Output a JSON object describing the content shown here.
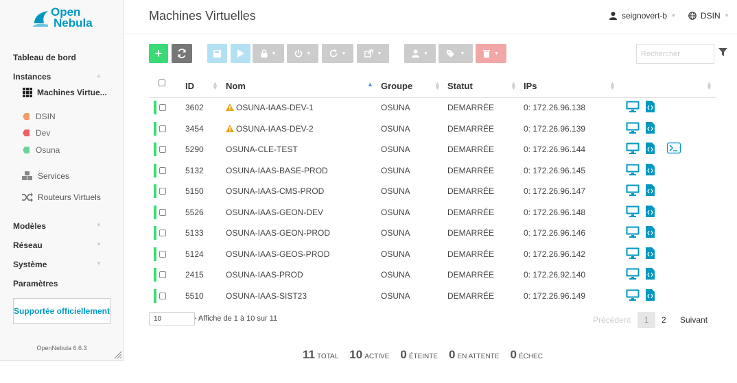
{
  "app": {
    "logo_line1": "Open",
    "logo_line2": "Nebula",
    "version": "OpenNebula 6.6.3"
  },
  "sidebar": {
    "dashboard": "Tableau de bord",
    "instances": "Instances",
    "vms": "Machines Virtue...",
    "tags": [
      {
        "label": "DSIN",
        "color": "#f59c6b"
      },
      {
        "label": "Dev",
        "color": "#ec5f67"
      },
      {
        "label": "Osuna",
        "color": "#6bd39a"
      }
    ],
    "services": "Services",
    "vrouters": "Routeurs Virtuels",
    "templates": "Modèles",
    "network": "Réseau",
    "system": "Système",
    "settings": "Paramètres",
    "support": "Supportée officiellement"
  },
  "header": {
    "title": "Machines Virtuelles",
    "user": "seignovert-b",
    "group": "DSIN"
  },
  "toolbar": {
    "search_placeholder": "Rechercher"
  },
  "colors": {
    "accent": "#0098c3",
    "create": "#3adb76",
    "refresh": "#777777",
    "disabled_blue": "#b3e0f2",
    "disabled_grey": "#cccccc",
    "disabled_red": "#f2a7a7",
    "running": "#3adb76"
  },
  "table": {
    "headers": {
      "id": "ID",
      "name": "Nom",
      "group": "Groupe",
      "status": "Statut",
      "ips": "IPs"
    },
    "rows": [
      {
        "id": "3602",
        "name": "OSUNA-IAAS-DEV-1",
        "group": "OSUNA",
        "status": "DEMARRÉE",
        "ip": "0: 172.26.96.138",
        "warn": true,
        "terminal": false
      },
      {
        "id": "3454",
        "name": "OSUNA-IAAS-DEV-2",
        "group": "OSUNA",
        "status": "DEMARRÉE",
        "ip": "0: 172.26.96.139",
        "warn": true,
        "terminal": false
      },
      {
        "id": "5290",
        "name": "OSUNA-CLE-TEST",
        "group": "OSUNA",
        "status": "DEMARRÉE",
        "ip": "0: 172.26.96.144",
        "warn": false,
        "terminal": true
      },
      {
        "id": "5132",
        "name": "OSUNA-IAAS-BASE-PROD",
        "group": "OSUNA",
        "status": "DEMARRÉE",
        "ip": "0: 172.26.96.145",
        "warn": false,
        "terminal": false
      },
      {
        "id": "5150",
        "name": "OSUNA-IAAS-CMS-PROD",
        "group": "OSUNA",
        "status": "DEMARRÉE",
        "ip": "0: 172.26.96.147",
        "warn": false,
        "terminal": false
      },
      {
        "id": "5526",
        "name": "OSUNA-IAAS-GEON-DEV",
        "group": "OSUNA",
        "status": "DEMARRÉE",
        "ip": "0: 172.26.96.148",
        "warn": false,
        "terminal": false
      },
      {
        "id": "5133",
        "name": "OSUNA-IAAS-GEON-PROD",
        "group": "OSUNA",
        "status": "DEMARRÉE",
        "ip": "0: 172.26.96.146",
        "warn": false,
        "terminal": false
      },
      {
        "id": "5124",
        "name": "OSUNA-IAAS-GEOS-PROD",
        "group": "OSUNA",
        "status": "DEMARRÉE",
        "ip": "0: 172.26.96.142",
        "warn": false,
        "terminal": false
      },
      {
        "id": "2415",
        "name": "OSUNA-IAAS-PROD",
        "group": "OSUNA",
        "status": "DEMARRÉE",
        "ip": "0: 172.26.92.140",
        "warn": false,
        "terminal": false
      },
      {
        "id": "5510",
        "name": "OSUNA-IAAS-SIST23",
        "group": "OSUNA",
        "status": "DEMARRÉE",
        "ip": "0: 172.26.96.149",
        "warn": false,
        "terminal": false
      }
    ]
  },
  "footer": {
    "page_size": "10",
    "paging_info": "Affiche de 1 à 10 sur 11",
    "prev": "Précédent",
    "pages": [
      "1",
      "2"
    ],
    "next": "Suivant"
  },
  "summary": [
    {
      "num": "11",
      "label": "TOTAL"
    },
    {
      "num": "10",
      "label": "ACTIVE"
    },
    {
      "num": "0",
      "label": "ÉTEINTE"
    },
    {
      "num": "0",
      "label": "EN ATTENTE"
    },
    {
      "num": "0",
      "label": "ÉCHEC"
    }
  ]
}
